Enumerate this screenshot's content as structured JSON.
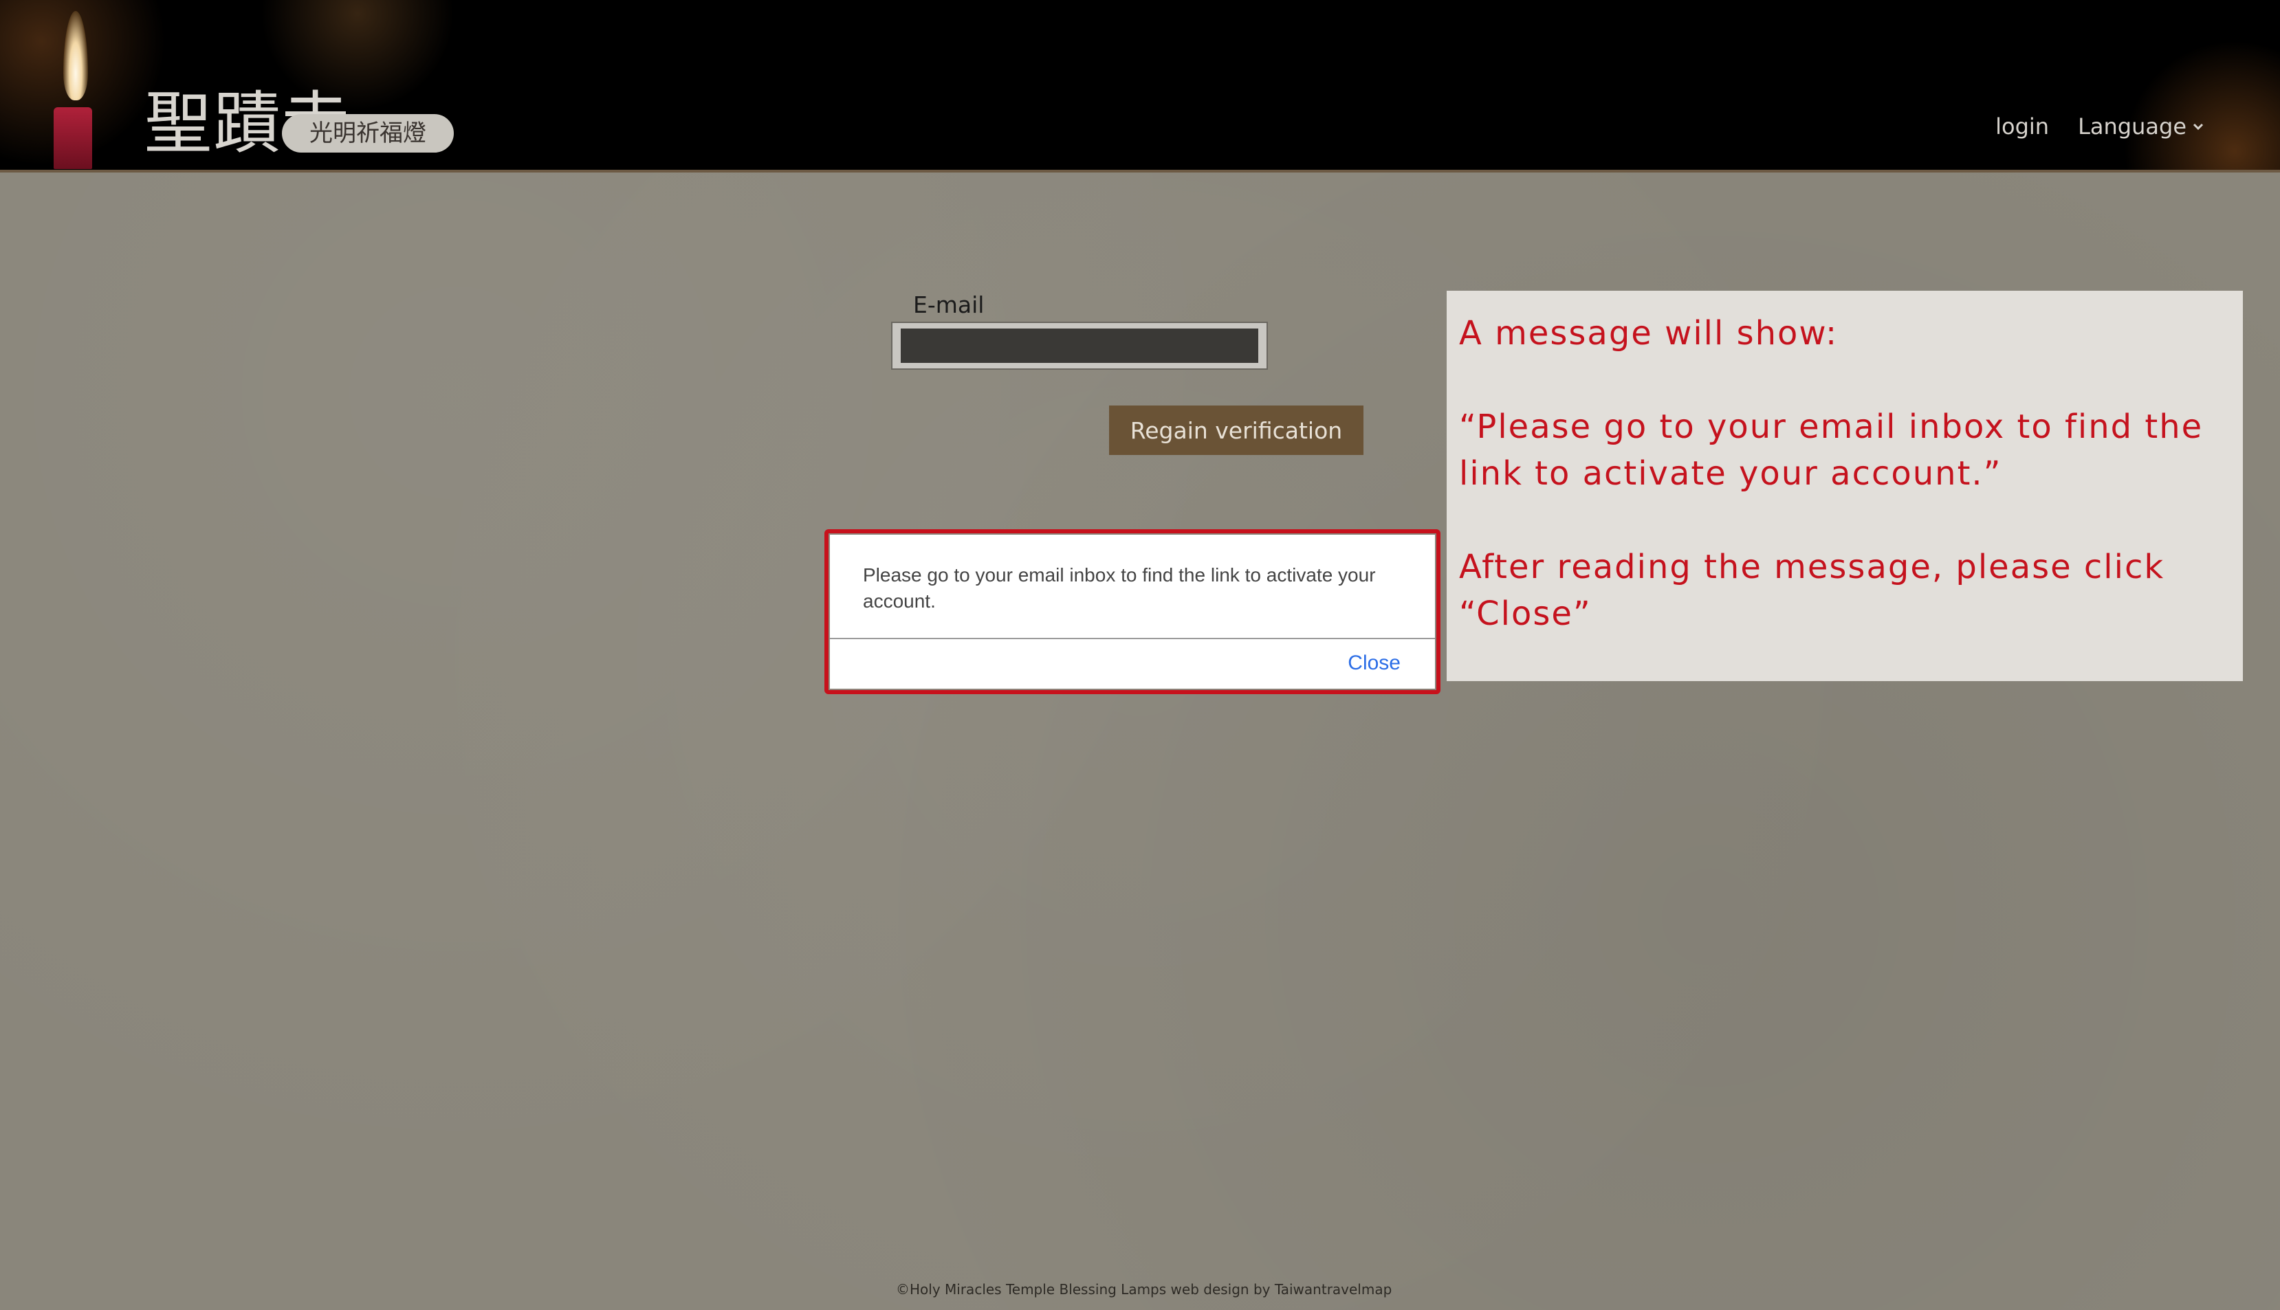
{
  "header": {
    "logo_title": "聖蹟寺",
    "logo_subtitle": "光明祈福燈",
    "nav": {
      "login": "login",
      "language": "Language"
    }
  },
  "form": {
    "email_label": "E-mail",
    "email_value": "",
    "regain_button": "Regain verification"
  },
  "dialog": {
    "message": "Please go to your email inbox to find the link to activate your account.",
    "close_label": "Close"
  },
  "annotation": {
    "line1": "A message will show:",
    "line2": "“Please go to your email inbox to find the link to activate your account.”",
    "line3": "After reading the message, please click “Close”",
    "color": "#c5121d"
  },
  "footer": {
    "text": "©Holy Miracles Temple Blessing Lamps web design  by  Taiwantravelmap"
  },
  "colors": {
    "header_bg": "#000000",
    "page_bg": "#8a867b",
    "button_bg": "#6a5336",
    "highlight_border": "#c7111c",
    "link_blue": "#2b6de6"
  }
}
